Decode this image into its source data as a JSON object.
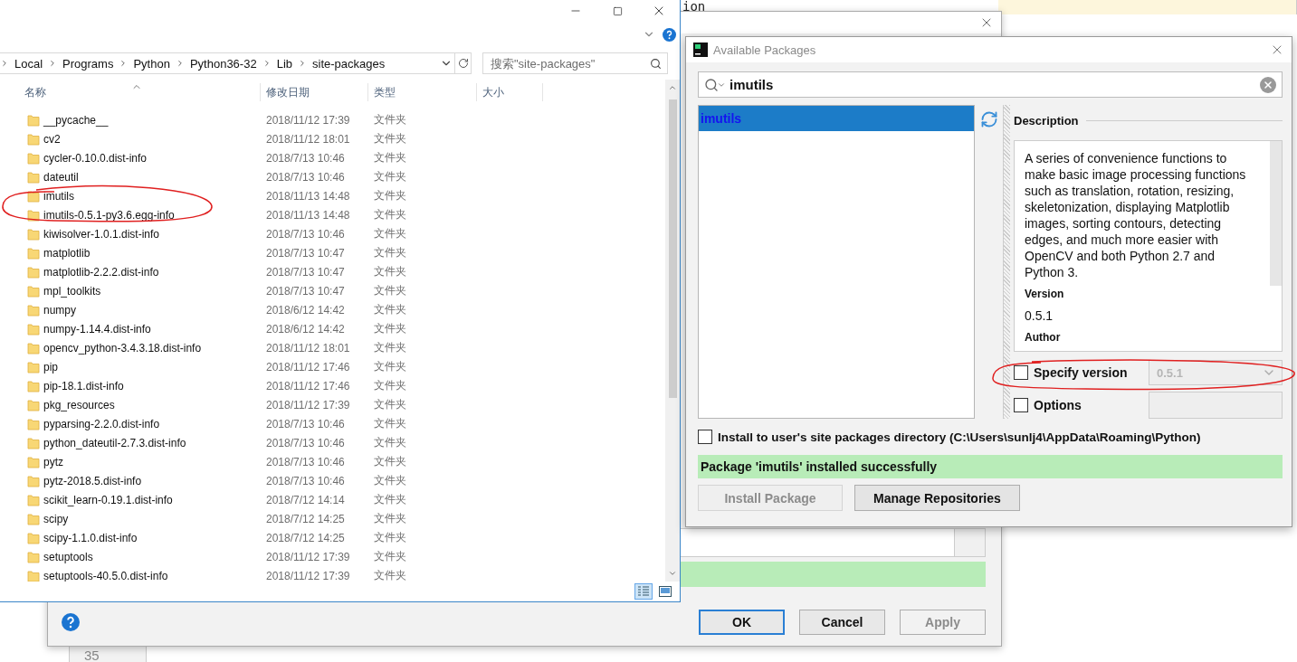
{
  "editor": {
    "code_fragment": "ion",
    "line_number": "35"
  },
  "settings_dialog": {
    "buttons": [
      {
        "label": "OK",
        "kind": "default",
        "disabled": false
      },
      {
        "label": "Cancel",
        "kind": "normal",
        "disabled": false
      },
      {
        "label": "Apply",
        "kind": "normal",
        "disabled": true
      }
    ]
  },
  "explorer": {
    "breadcrumb": [
      "Local",
      "Programs",
      "Python",
      "Python36-32",
      "Lib",
      "site-packages"
    ],
    "search": {
      "placeholder": "搜索\"site-packages\""
    },
    "columns": [
      "名称",
      "修改日期",
      "类型",
      "大小"
    ],
    "rows": [
      {
        "name": "__pycache__",
        "modified": "2018/11/12 17:39",
        "type": "文件夹"
      },
      {
        "name": "cv2",
        "modified": "2018/11/12 18:01",
        "type": "文件夹"
      },
      {
        "name": "cycler-0.10.0.dist-info",
        "modified": "2018/7/13 10:46",
        "type": "文件夹"
      },
      {
        "name": "dateutil",
        "modified": "2018/7/13 10:46",
        "type": "文件夹"
      },
      {
        "name": "imutils",
        "modified": "2018/11/13 14:48",
        "type": "文件夹"
      },
      {
        "name": "imutils-0.5.1-py3.6.egg-info",
        "modified": "2018/11/13 14:48",
        "type": "文件夹"
      },
      {
        "name": "kiwisolver-1.0.1.dist-info",
        "modified": "2018/7/13 10:46",
        "type": "文件夹"
      },
      {
        "name": "matplotlib",
        "modified": "2018/7/13 10:47",
        "type": "文件夹"
      },
      {
        "name": "matplotlib-2.2.2.dist-info",
        "modified": "2018/7/13 10:47",
        "type": "文件夹"
      },
      {
        "name": "mpl_toolkits",
        "modified": "2018/7/13 10:47",
        "type": "文件夹"
      },
      {
        "name": "numpy",
        "modified": "2018/6/12 14:42",
        "type": "文件夹"
      },
      {
        "name": "numpy-1.14.4.dist-info",
        "modified": "2018/6/12 14:42",
        "type": "文件夹"
      },
      {
        "name": "opencv_python-3.4.3.18.dist-info",
        "modified": "2018/11/12 18:01",
        "type": "文件夹"
      },
      {
        "name": "pip",
        "modified": "2018/11/12 17:46",
        "type": "文件夹"
      },
      {
        "name": "pip-18.1.dist-info",
        "modified": "2018/11/12 17:46",
        "type": "文件夹"
      },
      {
        "name": "pkg_resources",
        "modified": "2018/11/12 17:39",
        "type": "文件夹"
      },
      {
        "name": "pyparsing-2.2.0.dist-info",
        "modified": "2018/7/13 10:46",
        "type": "文件夹"
      },
      {
        "name": "python_dateutil-2.7.3.dist-info",
        "modified": "2018/7/13 10:46",
        "type": "文件夹"
      },
      {
        "name": "pytz",
        "modified": "2018/7/13 10:46",
        "type": "文件夹"
      },
      {
        "name": "pytz-2018.5.dist-info",
        "modified": "2018/7/13 10:46",
        "type": "文件夹"
      },
      {
        "name": "scikit_learn-0.19.1.dist-info",
        "modified": "2018/7/12 14:14",
        "type": "文件夹"
      },
      {
        "name": "scipy",
        "modified": "2018/7/12 14:25",
        "type": "文件夹"
      },
      {
        "name": "scipy-1.1.0.dist-info",
        "modified": "2018/7/12 14:25",
        "type": "文件夹"
      },
      {
        "name": "setuptools",
        "modified": "2018/11/12 17:39",
        "type": "文件夹"
      },
      {
        "name": "setuptools-40.5.0.dist-info",
        "modified": "2018/11/12 17:39",
        "type": "文件夹"
      }
    ]
  },
  "packages_dialog": {
    "title": "Available Packages",
    "search": {
      "value": "imutils"
    },
    "packages": [
      {
        "name": "imutils",
        "selected": true
      }
    ],
    "description_heading": "Description",
    "details": [
      {
        "kind": "text",
        "text": "A series of convenience functions to make basic image processing functions such as translation, rotation, resizing, skeletonization, displaying Matplotlib images, sorting contours, detecting edges, and much more easier with OpenCV and both Python 2.7 and Python 3."
      },
      {
        "kind": "label",
        "text": "Version"
      },
      {
        "kind": "text",
        "text": "0.5.1"
      },
      {
        "kind": "label",
        "text": "Author"
      }
    ],
    "specify_version": {
      "label": "Specify version",
      "checked": false,
      "value": "0.5.1",
      "disabled": true
    },
    "options": {
      "label": "Options",
      "checked": false
    },
    "install_to_user": {
      "label": "Install to user's site packages directory (C:\\Users\\sunlj4\\AppData\\Roaming\\Python)",
      "checked": false
    },
    "status": "Package 'imutils' installed successfully",
    "buttons": [
      {
        "label": "Install Package",
        "disabled": true
      },
      {
        "label": "Manage Repositories",
        "disabled": false
      }
    ]
  }
}
